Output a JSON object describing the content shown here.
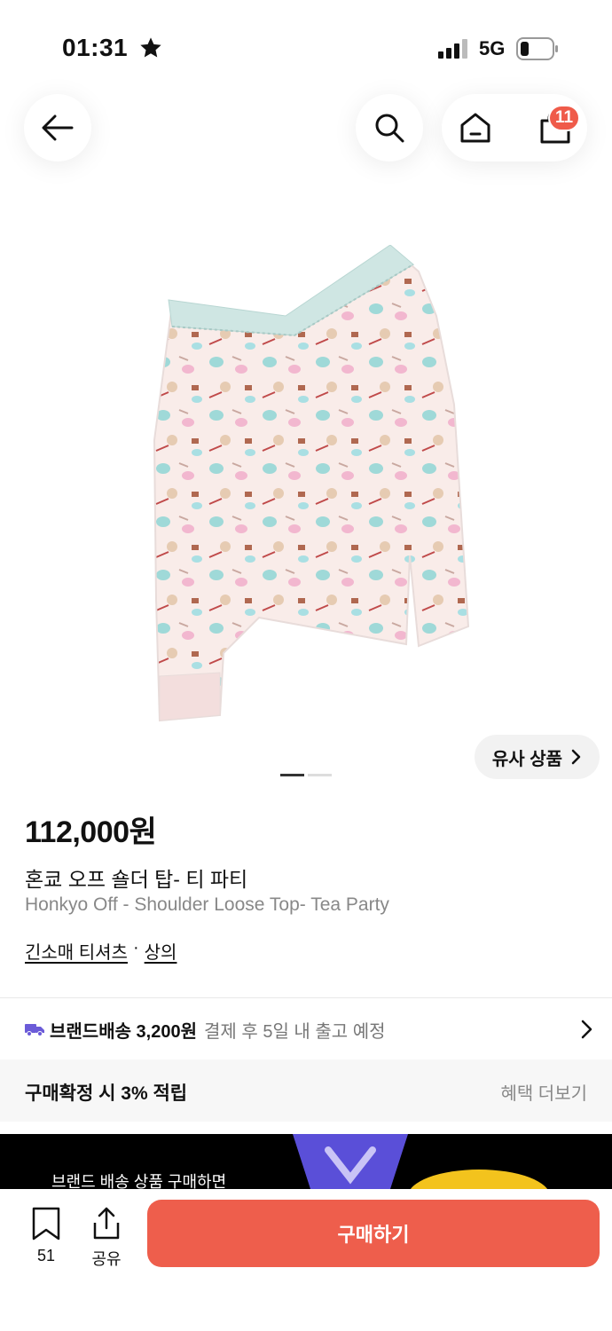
{
  "status_bar": {
    "time": "01:31",
    "network": "5G",
    "icons": [
      "star-icon",
      "signal-icon",
      "battery-icon"
    ]
  },
  "nav": {
    "icons": [
      "back-arrow-icon",
      "search-icon",
      "home-icon",
      "cart-icon"
    ],
    "cart_badge": "11"
  },
  "product": {
    "image_alt": "product-photo",
    "similar_label": "유사 상품",
    "gallery_total": 2,
    "gallery_active": 1,
    "price": "112,000원",
    "title_kr": "혼쿄 오프 숄더 탑- 티 파티",
    "title_en": "Honkyo Off - Shoulder Loose Top- Tea Party",
    "category_primary": "긴소매 티셔츠",
    "category_separator": "·",
    "category_secondary": "상의"
  },
  "shipping": {
    "icon": "truck-icon",
    "label": "브랜드배송 3,200원",
    "note": "결제 후 5일 내 출고 예정"
  },
  "reward": {
    "label": "구매확정 시 3% 적립",
    "more": "혜택 더보기"
  },
  "banner": {
    "text": "브랜드 배송 상품 구매하면"
  },
  "bottom_bar": {
    "bookmark_count": "51",
    "share_label": "공유",
    "buy_label": "구매하기"
  },
  "colors": {
    "accent": "#ee5e4c",
    "badge": "#ef5b4a",
    "shipping_icon": "#6b5bd8"
  }
}
